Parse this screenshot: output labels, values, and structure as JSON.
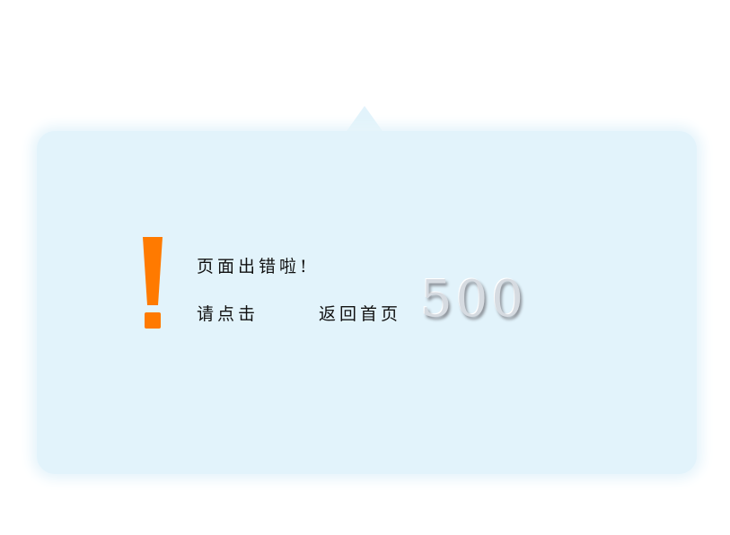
{
  "message": {
    "title": "页面出错啦!",
    "prompt": "请点击",
    "home_link": "返回首页",
    "code": "500"
  },
  "colors": {
    "panel_background": "#e2f3fb",
    "icon_accent": "#ff7a00",
    "code_text": "#d6dbe1"
  },
  "icons": {
    "alert": "exclamation-mark-icon"
  }
}
